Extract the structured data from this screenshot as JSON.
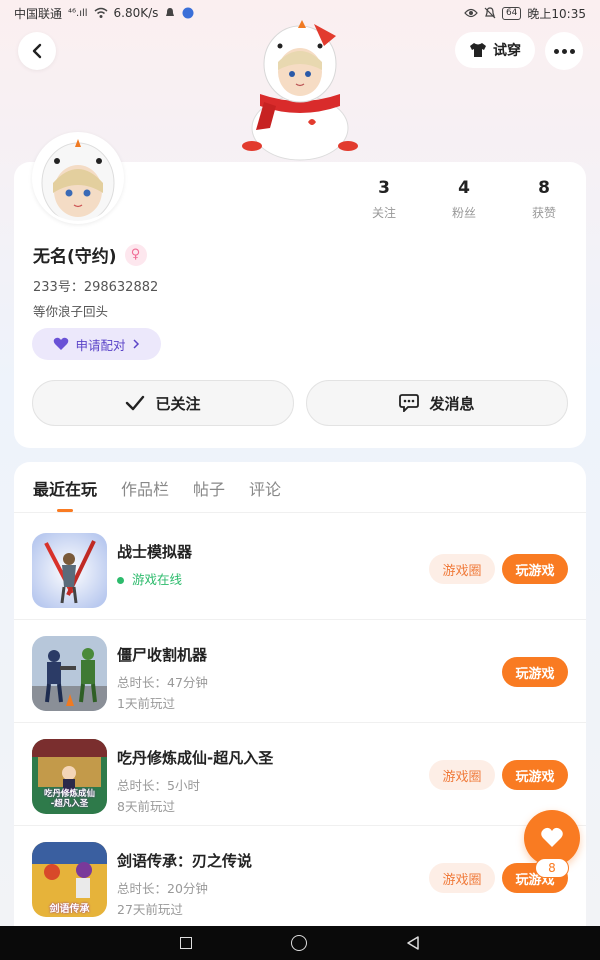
{
  "status_bar": {
    "carrier": "中国联通",
    "signal": "⁴⁶.ıll",
    "speed": "6.80K/s",
    "battery": "64",
    "time": "晚上10:35"
  },
  "header": {
    "try_label": "试穿"
  },
  "profile": {
    "stats": [
      {
        "num": "3",
        "label": "关注"
      },
      {
        "num": "4",
        "label": "粉丝"
      },
      {
        "num": "8",
        "label": "获赞"
      }
    ],
    "username": "无名(守约)",
    "gender_symbol": "♀",
    "uid": "233号：298632882",
    "signature": "等你浪子回头",
    "pair_label": "申请配对",
    "follow_label": "已关注",
    "message_label": "发消息"
  },
  "tabs": [
    "最近在玩",
    "作品栏",
    "帖子",
    "评论"
  ],
  "games": [
    {
      "title": "战士模拟器",
      "line1": "游戏在线",
      "line2": "",
      "online": true,
      "has_circle": true
    },
    {
      "title": "僵尸收割机器",
      "line1": "总时长：47分钟",
      "line2": "1天前玩过",
      "online": false,
      "has_circle": false
    },
    {
      "title": "吃丹修炼成仙-超凡入圣",
      "line1": "总时长：5小时",
      "line2": "8天前玩过",
      "online": false,
      "has_circle": true
    },
    {
      "title": "剑语传承：刃之传说",
      "line1": "总时长：20分钟",
      "line2": "27天前玩过",
      "online": false,
      "has_circle": true
    }
  ],
  "buttons": {
    "circle": "游戏圈",
    "play": "玩游戏"
  },
  "game_icon_text": {
    "icon3": "吃丹修炼成仙\n-超凡入圣",
    "icon4": "剑语传承"
  },
  "like_count": "8",
  "colors": {
    "accent": "#f97b22",
    "pair": "#5b44c8",
    "online": "#2dbb6c"
  }
}
